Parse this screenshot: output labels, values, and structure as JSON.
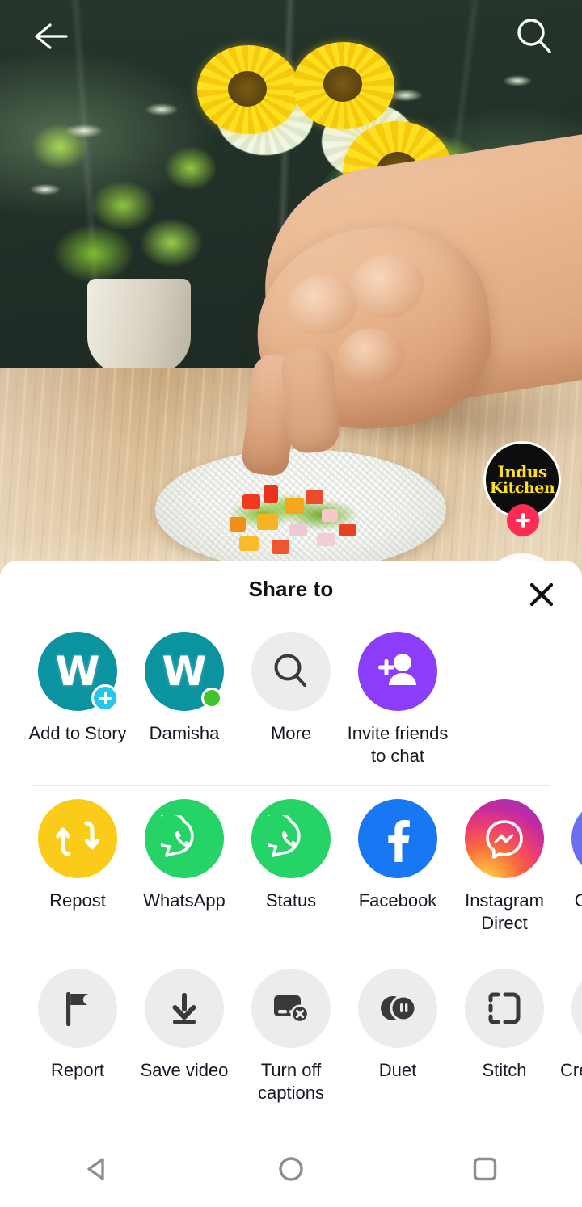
{
  "top_bar": {
    "back_icon": "arrow-left-icon",
    "search_icon": "search-icon"
  },
  "video": {
    "creator_avatar": {
      "line1": "Indus",
      "line2": "Kitchen",
      "follow_icon": "plus-icon",
      "follow_color": "#fe2c55"
    }
  },
  "sheet": {
    "title": "Share to",
    "close_icon": "close-icon",
    "rows": [
      {
        "name": "friends-row",
        "items": [
          {
            "label": "Add to Story",
            "icon": "user-avatar-w-icon",
            "badge": "plus-badge-icon",
            "style": "bub-teal"
          },
          {
            "label": "Damisha",
            "icon": "user-avatar-w-icon",
            "badge": "online-dot-icon",
            "style": "bub-teal"
          },
          {
            "label": "More",
            "icon": "search-icon",
            "style": "bub-grey"
          },
          {
            "label": "Invite friends to chat",
            "icon": "person-plus-icon",
            "style": "bub-purple"
          }
        ]
      },
      {
        "name": "apps-row",
        "items": [
          {
            "label": "Repost",
            "icon": "repost-arrows-icon",
            "style": "bub-yellow"
          },
          {
            "label": "WhatsApp",
            "icon": "whatsapp-icon",
            "style": "bub-wa"
          },
          {
            "label": "Status",
            "icon": "whatsapp-status-icon",
            "style": "bub-wa"
          },
          {
            "label": "Facebook",
            "icon": "facebook-icon",
            "style": "bub-fb"
          },
          {
            "label": "Instagram Direct",
            "icon": "messenger-bolt-icon",
            "style": "bub-ig"
          },
          {
            "label": "Copy link",
            "icon": "copy-link-icon",
            "style": "bub-indigo"
          }
        ]
      },
      {
        "name": "actions-row",
        "items": [
          {
            "label": "Report",
            "icon": "flag-icon",
            "style": "bub-grey"
          },
          {
            "label": "Save video",
            "icon": "download-icon",
            "style": "bub-grey"
          },
          {
            "label": "Turn off captions",
            "icon": "captions-off-icon",
            "style": "bub-grey"
          },
          {
            "label": "Duet",
            "icon": "duet-circles-icon",
            "style": "bub-grey"
          },
          {
            "label": "Stitch",
            "icon": "stitch-brackets-icon",
            "style": "bub-grey"
          },
          {
            "label": "Creator stats",
            "icon": "stats-icon",
            "style": "bub-grey"
          }
        ]
      }
    ]
  },
  "nav_bar": {
    "back_icon": "nav-back-triangle-icon",
    "home_icon": "nav-home-circle-icon",
    "recents_icon": "nav-recents-square-icon"
  },
  "colors": {
    "accent_red": "#fe2c55",
    "teal": "#0b93a0",
    "purple": "#8b3dfa",
    "yellow": "#fbcb19",
    "whatsapp_green": "#25d366",
    "facebook_blue": "#1877f2",
    "grey_bubble": "#ececec",
    "text": "#161823"
  }
}
